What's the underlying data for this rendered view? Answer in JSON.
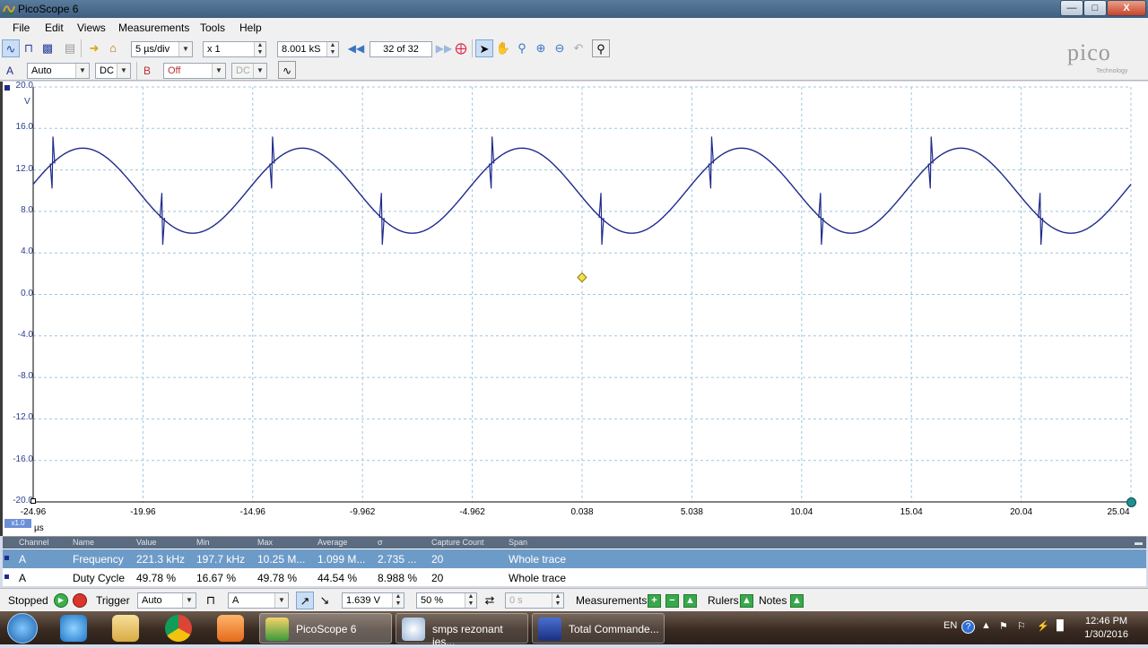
{
  "window": {
    "title": "PicoScope 6",
    "minimize": "—",
    "maximize": "□",
    "close": "X"
  },
  "menu": [
    "File",
    "Edit",
    "Views",
    "Measurements",
    "Tools",
    "Help"
  ],
  "toolbar": {
    "timebase": "5 µs/div",
    "zoom": "x 1",
    "samples": "8.001 kS",
    "capture": "32 of 32"
  },
  "channels": {
    "a_label": "A",
    "a_range": "Auto",
    "a_coupling": "DC",
    "b_label": "B",
    "b_range": "Off",
    "b_coupling": "DC"
  },
  "logo": {
    "brand": "pico",
    "sub": "Technology"
  },
  "plot": {
    "trace_color": "#1f2a8c",
    "y_unit": "V",
    "x_unit": "µs",
    "zoom_badge": "x1.0",
    "y_ticks": [
      "20.0",
      "16.0",
      "12.0",
      "8.0",
      "4.0",
      "0.0",
      "-4.0",
      "-8.0",
      "-12.0",
      "-16.0",
      "-20.0"
    ],
    "x_ticks": [
      "-24.96",
      "-19.96",
      "-14.96",
      "-9.962",
      "-4.962",
      "0.038",
      "5.038",
      "10.04",
      "15.04",
      "20.04",
      "25.04"
    ]
  },
  "measurements": {
    "headers": [
      "Channel",
      "Name",
      "Value",
      "Min",
      "Max",
      "Average",
      "σ",
      "Capture Count",
      "Span"
    ],
    "rows": [
      [
        "A",
        "Frequency",
        "221.3 kHz",
        "197.7 kHz",
        "10.25 M...",
        "1.099 M...",
        "2.735 ...",
        "20",
        "Whole trace"
      ],
      [
        "A",
        "Duty Cycle",
        "49.78 %",
        "16.67 %",
        "49.78 %",
        "44.54 %",
        "8.988 %",
        "20",
        "Whole trace"
      ]
    ]
  },
  "status": {
    "state": "Stopped",
    "trigger_label": "Trigger",
    "trigger_mode": "Auto",
    "trigger_source": "A",
    "trigger_level": "1.639 V",
    "pre_trigger": "50 %",
    "delay": "0 s",
    "measurements_label": "Measurements",
    "rulers_label": "Rulers",
    "notes_label": "Notes"
  },
  "taskbar": {
    "tasks": [
      "PicoScope 6",
      "smps rezonant ies...",
      "Total Commande..."
    ],
    "lang": "EN",
    "time": "12:46 PM",
    "date": "1/30/2016"
  }
}
